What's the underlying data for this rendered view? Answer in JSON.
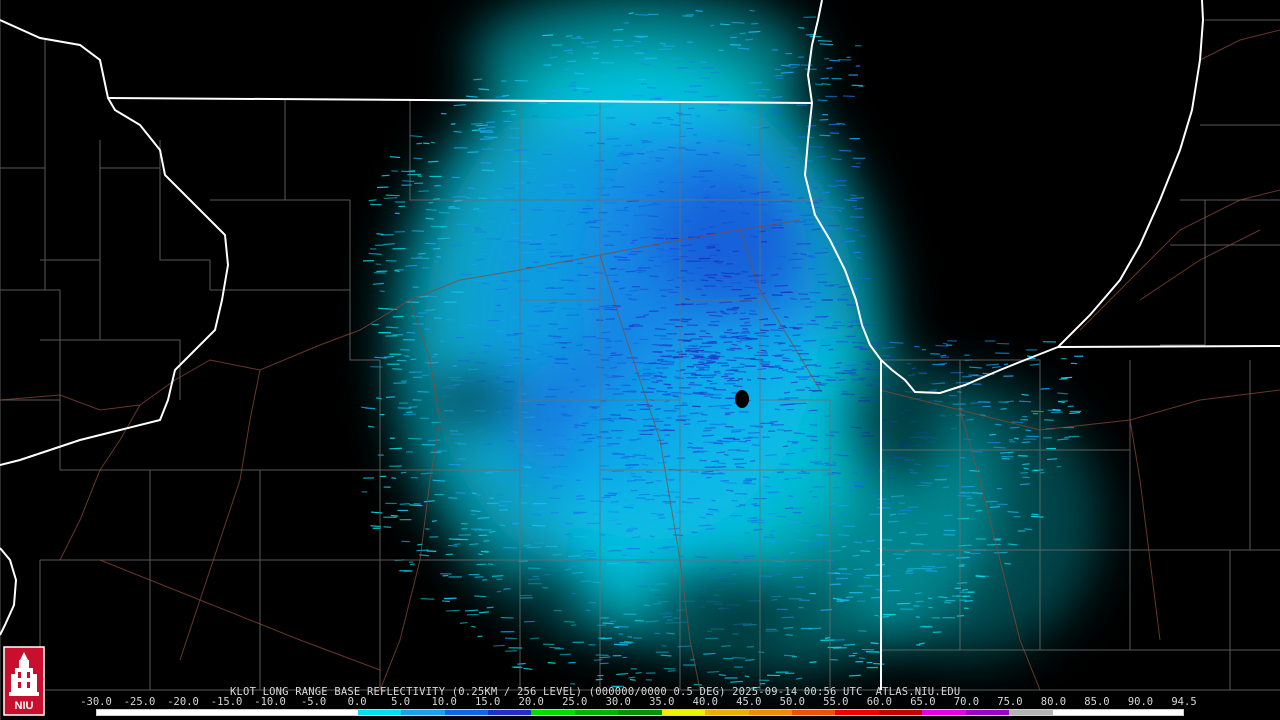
{
  "caption": {
    "text": "KLOT LONG RANGE BASE REFLECTIVITY (0.25KM / 256 LEVEL) (000000/0000 0.5 DEG) 2025-09-14 00:56 UTC  ATLAS.NIU.EDU"
  },
  "logo": {
    "text": "NIU",
    "color": "#c8102e",
    "icon": "university-tower-logo"
  },
  "legend": {
    "labels": [
      "-30.0",
      "-25.0",
      "-20.0",
      "-15.0",
      "-10.0",
      "-5.0",
      "0.0",
      "5.0",
      "10.0",
      "15.0",
      "20.0",
      "25.0",
      "30.0",
      "35.0",
      "40.0",
      "45.0",
      "50.0",
      "55.0",
      "60.0",
      "65.0",
      "70.0",
      "75.0",
      "80.0",
      "85.0",
      "90.0",
      "94.5"
    ],
    "colors": [
      "#ffffff",
      "#ffffff",
      "#ffffff",
      "#ffffff",
      "#ffffff",
      "#ffffff",
      "#00e0f0",
      "#1aa0f0",
      "#1464e6",
      "#1e32c8",
      "#00dc00",
      "#00b400",
      "#009600",
      "#f0f000",
      "#e6b400",
      "#f08c00",
      "#f05000",
      "#f00000",
      "#c80000",
      "#e600e6",
      "#a000c8",
      "#b4b4b4",
      "#ffffff",
      "#ffffff",
      "#ffffff"
    ]
  },
  "radar": {
    "site": "KLOT",
    "product": "Base Reflectivity",
    "echo_colors": [
      "#00e0f0",
      "#12c4f0",
      "#1aa0f0",
      "#1680ec",
      "#1464e6",
      "#1e4ad8",
      "#1e32c8"
    ],
    "blob_colors": [
      "#00e6f5",
      "#0fbcf2",
      "#1398ef",
      "#1678ea",
      "#1a5ce0",
      "#1e44d2"
    ]
  },
  "map_colors": {
    "background": "#000000",
    "state_line": "#ffffff",
    "county_line": "#6e6e6e",
    "highway_line": "#8a4a36"
  }
}
